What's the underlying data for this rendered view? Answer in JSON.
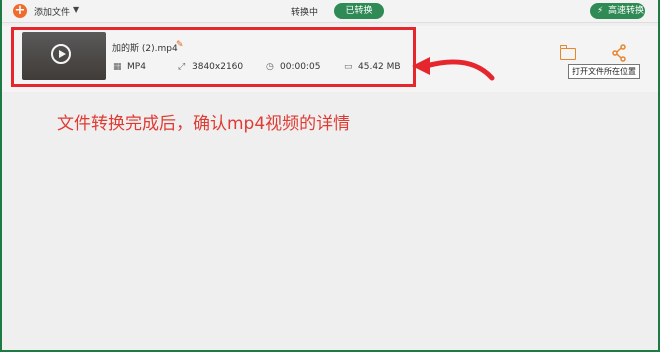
{
  "toolbar": {
    "add_file_label": "添加文件",
    "add_file_icon": "plus-circle-icon",
    "dropdown_icon": "chevron-down-icon",
    "tab_converting": "转换中",
    "tab_converted": "已转换",
    "fast_convert_label": "高速转换",
    "fast_convert_icon": "lightning-icon"
  },
  "file": {
    "name": "加的斯 (2).mp4",
    "format": "MP4",
    "resolution": "3840x2160",
    "duration": "00:00:05",
    "size": "45.42 MB",
    "thumbnail_icon": "play-icon",
    "edit_icon": "pencil-icon",
    "format_icon": "film-icon",
    "resolution_icon": "resize-icon",
    "duration_icon": "clock-icon",
    "size_icon": "folder-small-icon"
  },
  "actions": {
    "open_folder_icon": "folder-icon",
    "share_icon": "share-icon",
    "tooltip": "打开文件所在位置"
  },
  "annotation": {
    "caption": "文件转换完成后，确认mp4视频的详情",
    "color": "#e5262d"
  },
  "colors": {
    "accent_green": "#2f8a55",
    "orange": "#ef6b2e",
    "background": "#efefef"
  }
}
